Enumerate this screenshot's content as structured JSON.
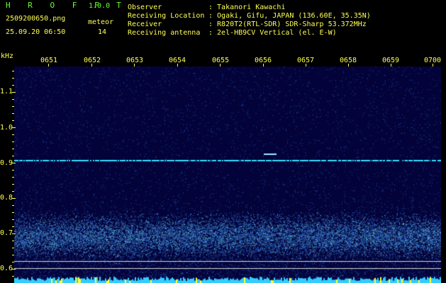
{
  "header": {
    "app_name": "H R O F F T",
    "version": "1.0.0",
    "filename": "2509200650.png",
    "timestamp": "25.09.20 06:50",
    "meteor_label": "meteor",
    "meteor_count": "14",
    "info": [
      {
        "label": "Observer",
        "value": ": Takanori Kawachi"
      },
      {
        "label": "Receiving Location",
        "value": ": Ogaki, Gifu, JAPAN (136.60E, 35.35N)"
      },
      {
        "label": "Receiver",
        "value": ": R820T2(RTL-SDR) SDR-Sharp 53.372MHz"
      },
      {
        "label": "Receiving antenna",
        "value": ": 2el-HB9CV Vertical (el. E-W)"
      }
    ]
  },
  "axes": {
    "y_unit": "kHz",
    "y_ticks": [
      "1.1",
      "1.0",
      "0.9",
      "0.8",
      "0.7",
      "0.6"
    ],
    "x_ticks": [
      "0651",
      "0652",
      "0653",
      "0654",
      "0655",
      "0656",
      "0657",
      "0658",
      "0659",
      "0700"
    ]
  },
  "colors": {
    "background": "#000000",
    "plot_bg": "#03033a",
    "label_yellow": "#ffff55",
    "label_green": "#66ff33",
    "signal_cyan": "#33ddff",
    "noise_blue": "#1a3fd0"
  }
}
